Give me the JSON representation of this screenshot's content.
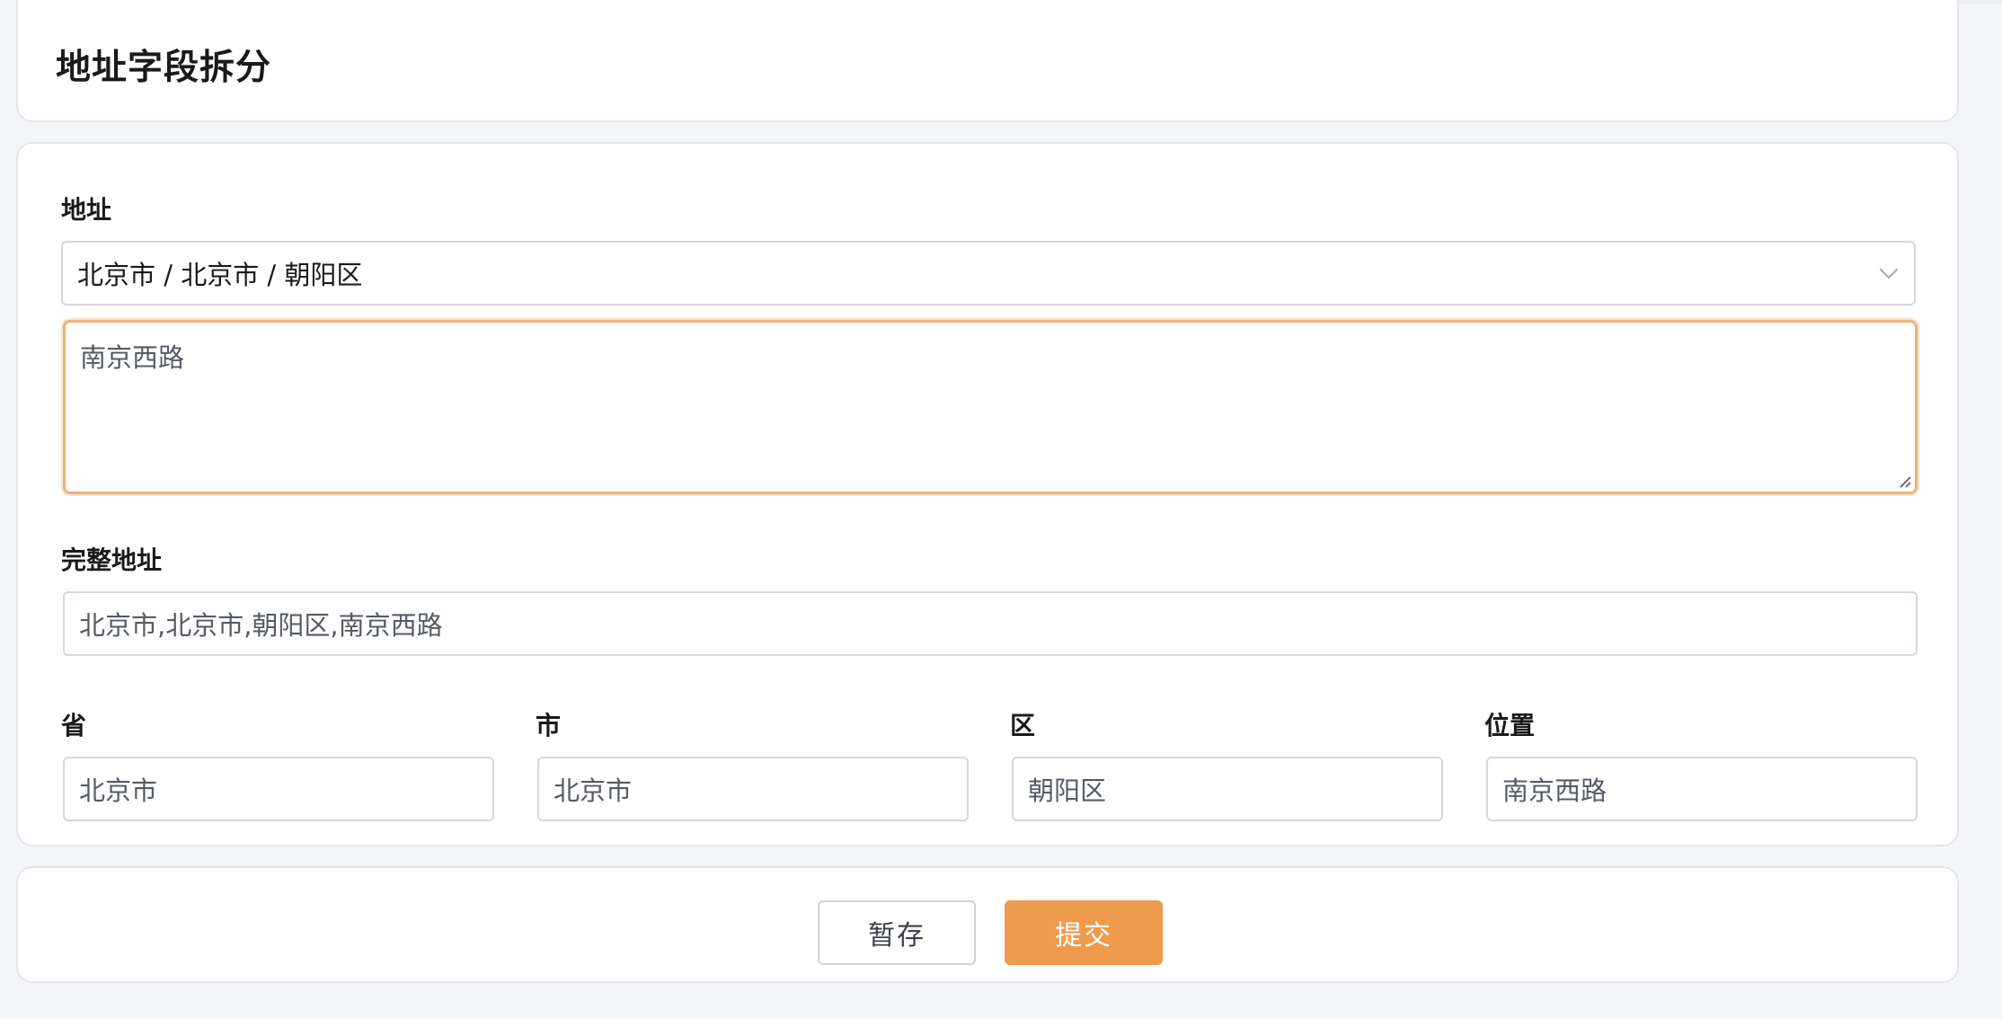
{
  "header": {
    "title": "地址字段拆分"
  },
  "form": {
    "address": {
      "label": "地址",
      "region_value": "北京市 / 北京市 / 朝阳区",
      "detail_value": "南京西路"
    },
    "full_address": {
      "label": "完整地址",
      "value": "北京市,北京市,朝阳区,南京西路"
    },
    "province": {
      "label": "省",
      "value": "北京市"
    },
    "city": {
      "label": "市",
      "value": "北京市"
    },
    "district": {
      "label": "区",
      "value": "朝阳区"
    },
    "location": {
      "label": "位置",
      "value": "南京西路"
    }
  },
  "footer": {
    "save_label": "暂存",
    "submit_label": "提交"
  },
  "colors": {
    "accent": "#ef9b4d",
    "focus_border": "#f1b27a",
    "page_background": "#f5f6f9",
    "card_border": "#e4e6ec"
  },
  "icons": {
    "cascader": "chevron-down-icon",
    "textarea": "resize-handle-icon"
  }
}
